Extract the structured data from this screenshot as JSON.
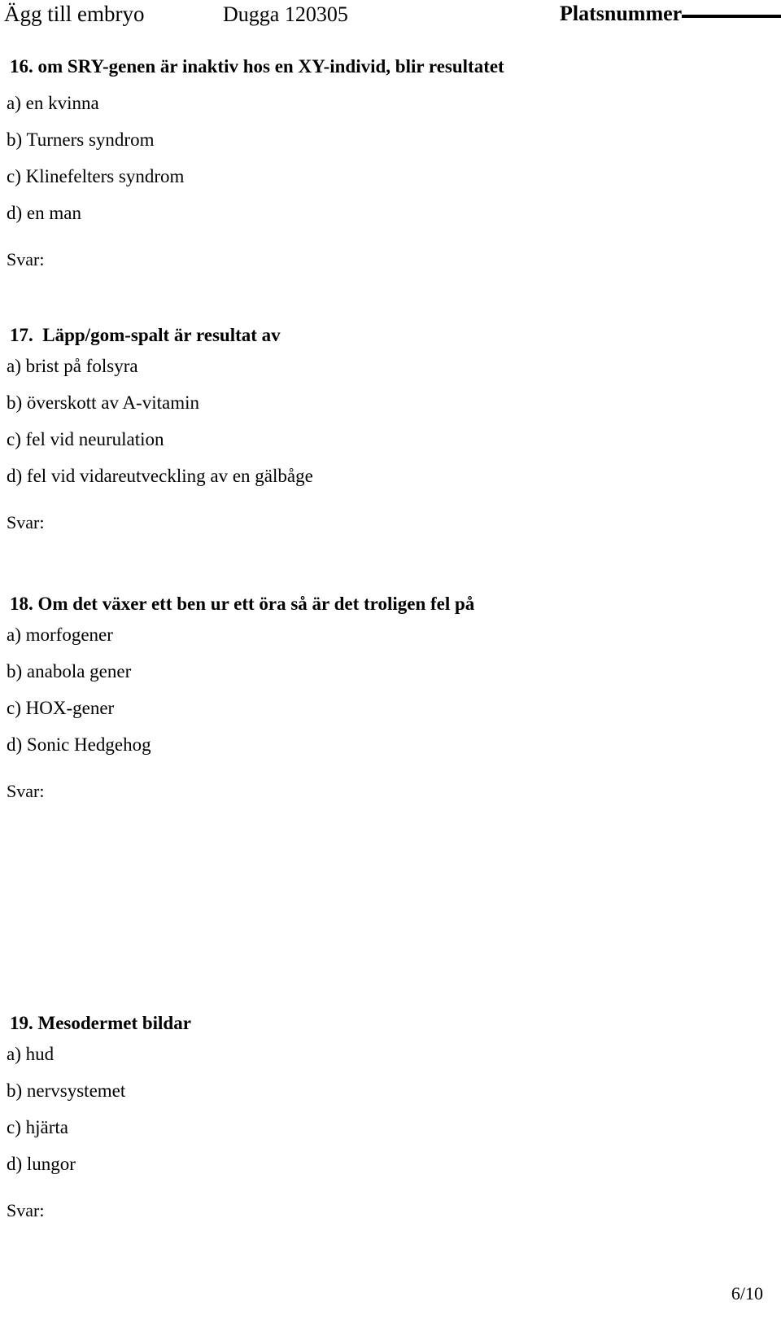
{
  "header": {
    "title": "Ägg till embryo",
    "exam": "Dugga 120305",
    "seat_label": "Platsnummer",
    "seat_value": ""
  },
  "answer_label": "Svar:",
  "questions": [
    {
      "number": "16.",
      "heading": "16. om SRY-genen är inaktiv hos en XY-individ, blir resultatet",
      "options": [
        "a) en kvinna",
        "b) Turners syndrom",
        "c) Klinefelters syndrom",
        "d) en man"
      ],
      "answer": "Svar:"
    },
    {
      "number": "17.",
      "heading": "17.  Läpp/gom-spalt är resultat av",
      "options": [
        "a) brist på folsyra",
        "b) överskott av A-vitamin",
        "c) fel vid neurulation",
        "d) fel vid vidareutveckling av en gälbåge"
      ],
      "answer": "Svar:"
    },
    {
      "number": "18.",
      "heading": "18. Om det växer ett ben ur ett öra så är det troligen fel på",
      "options": [
        "a) morfogener",
        "b) anabola gener",
        "c) HOX-gener",
        "d) Sonic Hedgehog"
      ],
      "answer": "Svar:"
    },
    {
      "number": "19.",
      "heading": "19. Mesodermet bildar",
      "options": [
        "a) hud",
        "b) nervsystemet",
        "c) hjärta",
        "d) lungor"
      ],
      "answer": "Svar:"
    }
  ],
  "footer": {
    "page_number": "6/10"
  },
  "colors": {
    "text": "#000000",
    "background": "#ffffff"
  }
}
